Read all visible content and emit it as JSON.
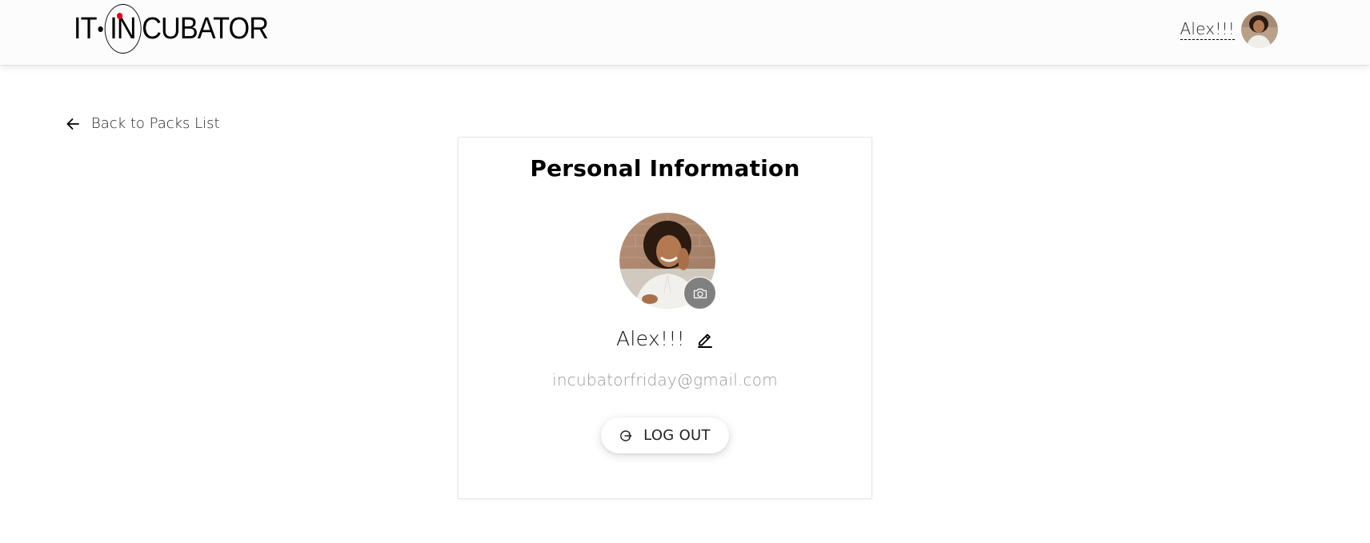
{
  "header": {
    "logo": {
      "left": "IT",
      "middle": "IN",
      "right": "CUBATOR"
    },
    "user_name": "Alex!!!",
    "avatar_icon": "user-avatar-photo"
  },
  "nav": {
    "back_label": "Back to Packs List",
    "back_icon": "arrow-left-icon"
  },
  "profile": {
    "title": "Personal Information",
    "name": "Alex!!!",
    "email": "incubatorfriday@gmail.com",
    "camera_icon": "camera-icon",
    "edit_icon": "pencil-icon",
    "logout_label": "LOG OUT",
    "logout_icon": "logout-icon"
  },
  "colors": {
    "logo_accent": "#e3001b",
    "camera_button_bg": "#808080",
    "email_text": "#9a9a9a"
  }
}
